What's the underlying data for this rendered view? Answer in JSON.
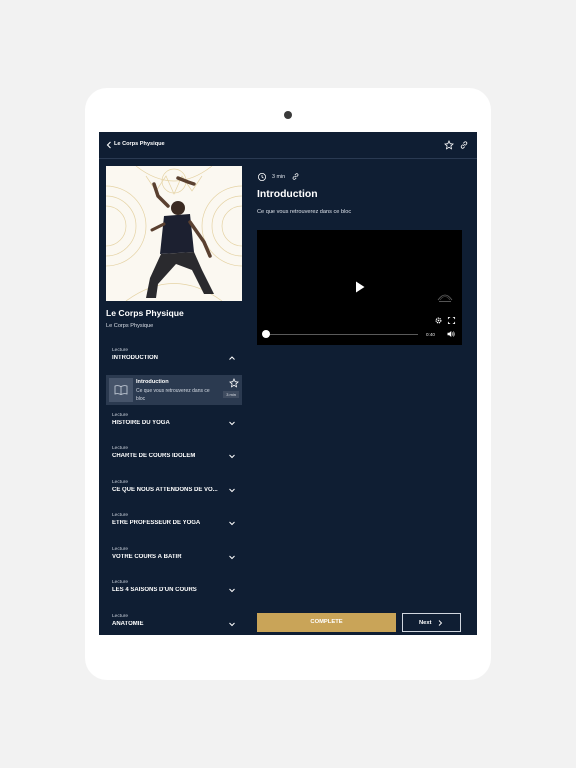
{
  "header": {
    "title": "Le Corps Physique",
    "back_icon": "chevron-left-icon",
    "favorite_icon": "star-icon",
    "share_icon": "link-icon"
  },
  "course": {
    "title": "Le Corps Physique",
    "subtitle": "Le Corps Physique"
  },
  "sections": [
    {
      "type": "Lecture",
      "name": "INTRODUCTION",
      "expanded": true
    },
    {
      "type": "Lecture",
      "name": "HISTOIRE DU YOGA",
      "expanded": false
    },
    {
      "type": "Lecture",
      "name": "CHARTE DE COURS IDOLEM",
      "expanded": false
    },
    {
      "type": "Lecture",
      "name": "CE QUE NOUS ATTENDONS DE VO...",
      "expanded": false
    },
    {
      "type": "Lecture",
      "name": "ÊTRE PROFESSEUR DE YOGA",
      "expanded": false
    },
    {
      "type": "Lecture",
      "name": "VOTRE COURS À BATIR",
      "expanded": false
    },
    {
      "type": "Lecture",
      "name": "LES 4 SAISONS D'UN COURS",
      "expanded": false
    },
    {
      "type": "Lecture",
      "name": "ANATOMIE",
      "expanded": false
    }
  ],
  "active_lesson": {
    "title": "Introduction",
    "description": "Ce que vous retrouverez dans ce bloc",
    "duration": "3 min",
    "icon": "book-icon"
  },
  "lesson": {
    "duration": "3 min",
    "title": "Introduction",
    "description": "Ce que vous retrouverez dans ce bloc"
  },
  "video": {
    "time": "0:40",
    "progress": 0.0
  },
  "actions": {
    "complete_label": "COMPLETE",
    "next_label": "Next"
  },
  "colors": {
    "background": "#0f1e33",
    "accent": "#c9a458",
    "selected_row": "#2b3a50"
  }
}
